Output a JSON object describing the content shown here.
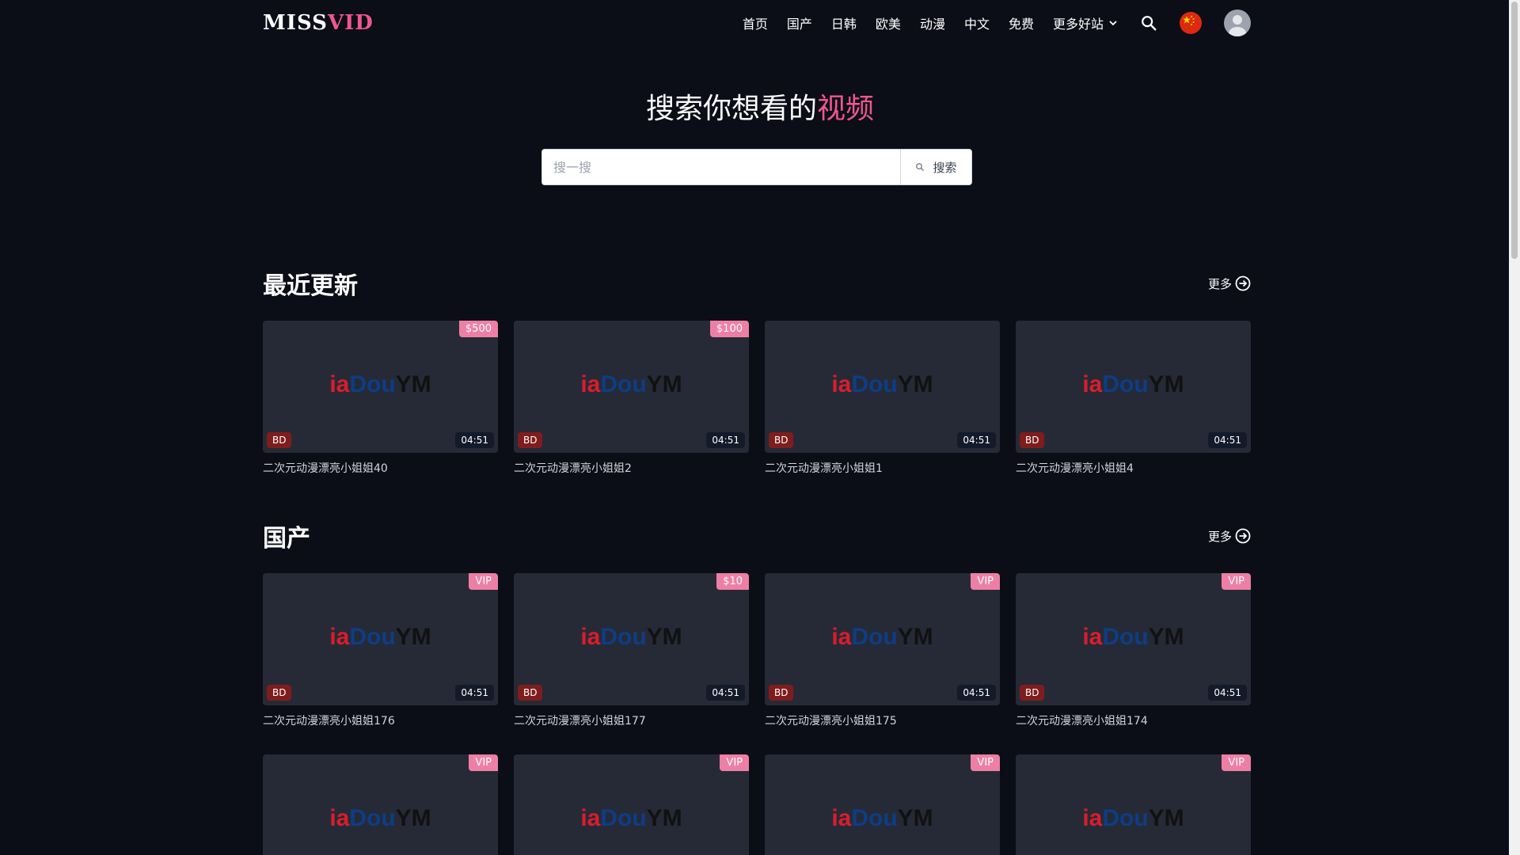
{
  "logo": {
    "part1": "MISS",
    "part2": "VID"
  },
  "nav": {
    "items": [
      "首页",
      "国产",
      "日韩",
      "欧美",
      "动漫",
      "中文",
      "免费"
    ],
    "more_label": "更多好站"
  },
  "hero": {
    "title_main": "搜索你想看的",
    "title_highlight": "视频"
  },
  "search": {
    "placeholder": "搜一搜",
    "value": "",
    "button_label": "搜索"
  },
  "watermark": {
    "p1": "i",
    "p2": "a",
    "p3": "Dou",
    "p4": "YM"
  },
  "sections": [
    {
      "title": "最近更新",
      "more_label": "更多",
      "cards": [
        {
          "tag": "$500",
          "quality": "BD",
          "duration": "04:51",
          "title": "二次元动漫漂亮小姐姐40"
        },
        {
          "tag": "$100",
          "quality": "BD",
          "duration": "04:51",
          "title": "二次元动漫漂亮小姐姐2"
        },
        {
          "tag": "",
          "quality": "BD",
          "duration": "04:51",
          "title": "二次元动漫漂亮小姐姐1"
        },
        {
          "tag": "",
          "quality": "BD",
          "duration": "04:51",
          "title": "二次元动漫漂亮小姐姐4"
        }
      ]
    },
    {
      "title": "国产",
      "more_label": "更多",
      "cards": [
        {
          "tag": "VIP",
          "quality": "BD",
          "duration": "04:51",
          "title": "二次元动漫漂亮小姐姐176"
        },
        {
          "tag": "$10",
          "quality": "BD",
          "duration": "04:51",
          "title": "二次元动漫漂亮小姐姐177"
        },
        {
          "tag": "VIP",
          "quality": "BD",
          "duration": "04:51",
          "title": "二次元动漫漂亮小姐姐175"
        },
        {
          "tag": "VIP",
          "quality": "BD",
          "duration": "04:51",
          "title": "二次元动漫漂亮小姐姐174"
        }
      ],
      "cards_row2": [
        {
          "tag": "VIP"
        },
        {
          "tag": "VIP"
        },
        {
          "tag": "VIP"
        },
        {
          "tag": "VIP"
        }
      ]
    }
  ],
  "colors": {
    "background": "#0b0d17",
    "accent": "#f0568f",
    "tag_pink": "#ee7fa4",
    "bd_badge": "#7f1d1d",
    "card_bg": "#262a36"
  },
  "icons": {
    "search": "search-icon",
    "flag": "china-flag-icon",
    "avatar": "user-avatar-icon",
    "chevron": "chevron-down-icon",
    "more": "arrow-circle-right-icon"
  }
}
